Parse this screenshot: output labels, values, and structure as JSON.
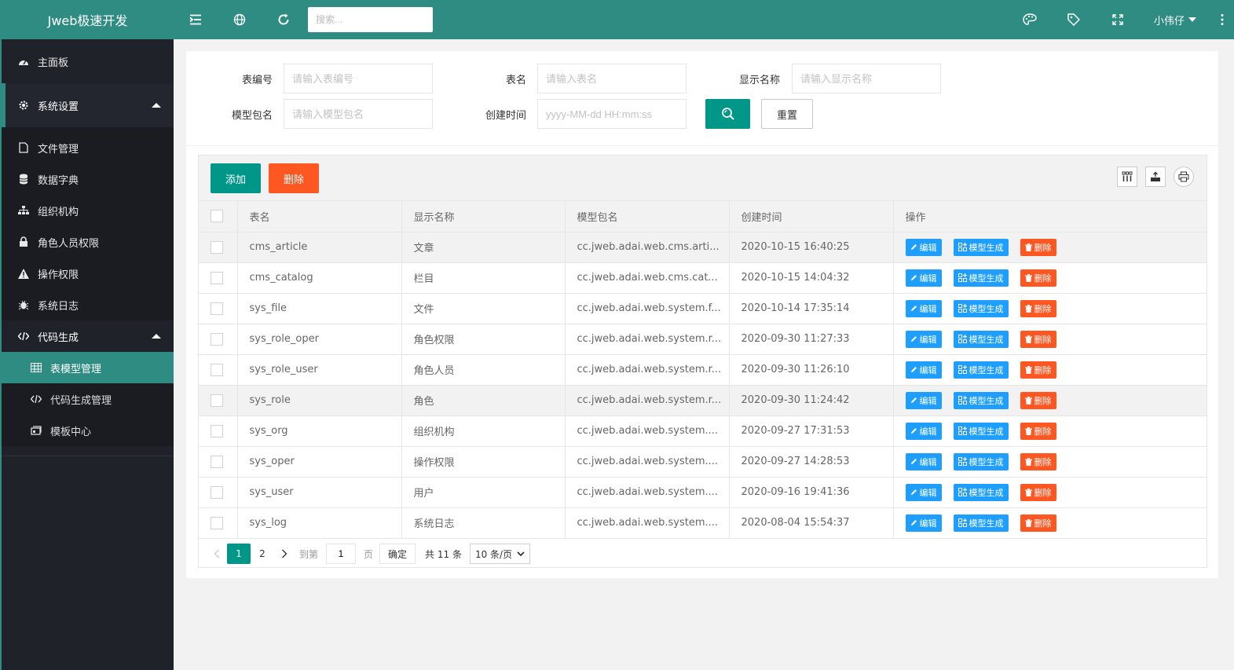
{
  "app": {
    "title": "Jweb极速开发"
  },
  "header": {
    "search_placeholder": "搜索...",
    "user_name": "小伟仔"
  },
  "sidebar": {
    "items": [
      {
        "label": "主面板",
        "icon": "dashboard-icon"
      },
      {
        "label": "系统设置",
        "icon": "gear-icon"
      }
    ],
    "system_sub": [
      {
        "label": "文件管理",
        "icon": "file-icon"
      },
      {
        "label": "数据字典",
        "icon": "database-icon"
      },
      {
        "label": "组织机构",
        "icon": "sitemap-icon"
      },
      {
        "label": "角色人员权限",
        "icon": "lock-icon"
      },
      {
        "label": "操作权限",
        "icon": "warning-icon"
      },
      {
        "label": "系统日志",
        "icon": "bug-icon"
      }
    ],
    "code_gen": {
      "label": "代码生成",
      "icon": "code-icon"
    },
    "code_sub": [
      {
        "label": "表模型管理",
        "icon": "table-icon"
      },
      {
        "label": "代码生成管理",
        "icon": "code-icon"
      },
      {
        "label": "模板中心",
        "icon": "template-icon"
      }
    ]
  },
  "filter": {
    "table_no_label": "表编号",
    "table_no_placeholder": "请输入表编号",
    "table_name_label": "表名",
    "table_name_placeholder": "请输入表名",
    "display_name_label": "显示名称",
    "display_name_placeholder": "请输入显示名称",
    "package_label": "模型包名",
    "package_placeholder": "请输入模型包名",
    "created_label": "创建时间",
    "created_placeholder": "yyyy-MM-dd HH:mm:ss",
    "reset_label": "重置"
  },
  "toolbar": {
    "add_label": "添加",
    "delete_label": "删除"
  },
  "table": {
    "headers": [
      "表名",
      "显示名称",
      "模型包名",
      "创建时间",
      "操作"
    ],
    "ops": {
      "edit": "编辑",
      "gen": "模型生成",
      "remove": "删除"
    },
    "rows": [
      {
        "name": "cms_article",
        "display": "文章",
        "package": "cc.jweb.adai.web.cms.arti...",
        "created": "2020-10-15 16:40:25"
      },
      {
        "name": "cms_catalog",
        "display": "栏目",
        "package": "cc.jweb.adai.web.cms.cat...",
        "created": "2020-10-15 14:04:32"
      },
      {
        "name": "sys_file",
        "display": "文件",
        "package": "cc.jweb.adai.web.system.f...",
        "created": "2020-10-14 17:35:14"
      },
      {
        "name": "sys_role_oper",
        "display": "角色权限",
        "package": "cc.jweb.adai.web.system.r...",
        "created": "2020-09-30 11:27:33"
      },
      {
        "name": "sys_role_user",
        "display": "角色人员",
        "package": "cc.jweb.adai.web.system.r...",
        "created": "2020-09-30 11:26:10"
      },
      {
        "name": "sys_role",
        "display": "角色",
        "package": "cc.jweb.adai.web.system.r...",
        "created": "2020-09-30 11:24:42"
      },
      {
        "name": "sys_org",
        "display": "组织机构",
        "package": "cc.jweb.adai.web.system....",
        "created": "2020-09-27 17:31:53"
      },
      {
        "name": "sys_oper",
        "display": "操作权限",
        "package": "cc.jweb.adai.web.system....",
        "created": "2020-09-27 14:28:53"
      },
      {
        "name": "sys_user",
        "display": "用户",
        "package": "cc.jweb.adai.web.system....",
        "created": "2020-09-16 19:41:36"
      },
      {
        "name": "sys_log",
        "display": "系统日志",
        "package": "cc.jweb.adai.web.system....",
        "created": "2020-08-04 15:54:37"
      }
    ]
  },
  "pager": {
    "pages": [
      "1",
      "2"
    ],
    "goto_label": "到第",
    "goto_value": "1",
    "page_unit": "页",
    "confirm_label": "确定",
    "total_label": "共 11 条",
    "page_size": "10 条/页"
  },
  "colors": {
    "primary": "#009688",
    "header": "#2f8c82",
    "danger": "#ff5722",
    "info": "#1e9fff",
    "sidebar": "#20222a"
  }
}
